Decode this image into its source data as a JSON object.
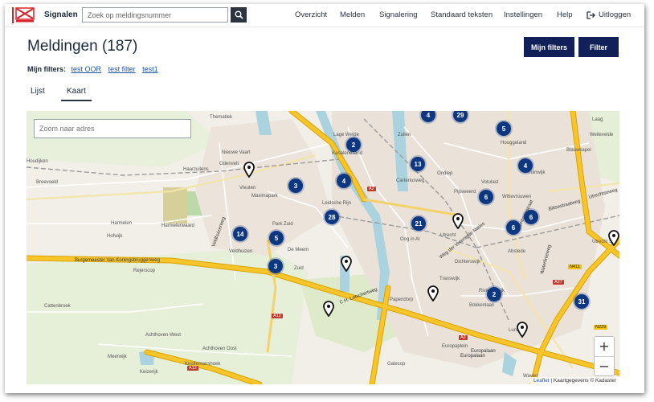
{
  "header": {
    "brand": "Signalen",
    "logo_name": "gemeente-utrecht-logo",
    "search_placeholder": "Zoek op meldingsnummer",
    "nav": [
      "Overzicht",
      "Melden",
      "Signalering",
      "Standaard teksten",
      "Instellingen",
      "Help"
    ],
    "logout": "Uitloggen"
  },
  "page": {
    "title": "Meldingen (187)",
    "buttons": {
      "my_filters": "Mijn filters",
      "filter": "Filter"
    },
    "filters_label": "Mijn filters:",
    "filters": [
      "test OOR",
      "test filter",
      "test1"
    ],
    "tabs": [
      "Lijst",
      "Kaart"
    ],
    "active_tab": "Kaart"
  },
  "map": {
    "zoom_placeholder": "Zoom naar adres",
    "zoom_in": "+",
    "zoom_out": "−",
    "attribution_link": "Leaflet",
    "attribution_text": " | Kaartgegevens © Kadaster",
    "clusters": [
      "4",
      "29",
      "5",
      "2",
      "13",
      "4",
      "3",
      "4",
      "6",
      "28",
      "6",
      "14",
      "5",
      "21",
      "6",
      "3",
      "2",
      "31"
    ],
    "place_labels": [
      "Thematiek",
      "Nieuwe Vaart",
      "Odenvelt",
      "Vleuten",
      "Maximapark",
      "Haarzuilens",
      "Houdijken",
      "Breevoeld",
      "Harmelen",
      "Harmelerwaard",
      "Hofwijk",
      "Veldhuizen",
      "Rejerscop",
      "Park Zuid",
      "De Meern",
      "Leidsche Rijn",
      "Zuid",
      "Lage Weide",
      "Zuilen",
      "Ondiep",
      "Carteriusweg",
      "Pijlsweerd",
      "Votulast",
      "Tuinwijk",
      "Wittevrouwen",
      "Blauwkapel",
      "Oog in Al",
      "Utrecht",
      "Dichterswijk",
      "Transwijk",
      "Rivierenwijk",
      "Abstede",
      "Lunetten",
      "Papendorp",
      "Bokkenlaan",
      "Europaplein",
      "Galecop",
      "Cattenbroek",
      "Achthoven-West",
      "Achthoven Oost",
      "Knollemanshoek",
      "Keizerijk",
      "Meerwijk",
      "Wayen",
      "Utrecht Sci",
      "Hooggeland",
      "Wellevelde",
      "Laag",
      "Kanaleneiland"
    ],
    "road_labels": [
      "Burgemeester Van Koningsbruggenweg",
      "C.H. Letschertweg",
      "Weg der Verenigde Naties",
      "Europalaan",
      "Veldhuizerweg",
      "Cattenhagestraat",
      "Waterlinieweg",
      "Biltsestraatweg",
      "Utrechtseweg",
      "Europalaan"
    ],
    "road_shields": [
      "A2",
      "A2",
      "A12",
      "A12",
      "N229",
      "N411",
      "A27"
    ]
  },
  "colors": {
    "primary_button": "#12205a",
    "cluster": "#0e3782",
    "link": "#1f56a8",
    "map_background": "#f2efe9",
    "highway": "#f7c52b",
    "water": "#aad3df"
  }
}
